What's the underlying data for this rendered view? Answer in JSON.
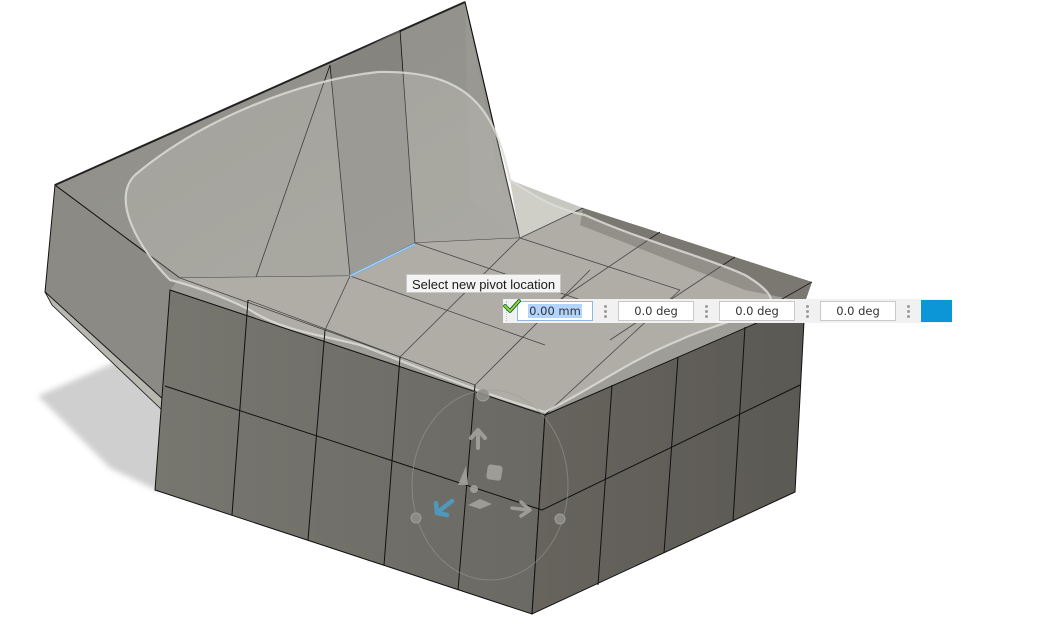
{
  "viewport": {
    "mode": "edit-form-transform",
    "background": "#ffffff",
    "model_color": "#8a8882",
    "selected_edge_color": "#4ea3f2"
  },
  "tooltip": {
    "text": "Select new pivot location"
  },
  "manipulator_toolbar": {
    "fields": [
      {
        "name": "distance",
        "value": "0.00 mm",
        "active": true
      },
      {
        "name": "rotation-1",
        "value": "0.0 deg",
        "active": false
      },
      {
        "name": "rotation-2",
        "value": "0.0 deg",
        "active": false
      },
      {
        "name": "rotation-3",
        "value": "0.0 deg",
        "active": false
      }
    ],
    "ok_button": {
      "icon": "checkmark-icon",
      "color": "#0d96d7"
    }
  },
  "gizmo": {
    "icons": [
      "arrow-up-icon",
      "arrow-right-icon",
      "arrow-left-down-icon",
      "plane-square-icon",
      "plane-diamond-icon",
      "rotation-ring-icon",
      "pivot-dot-icon"
    ],
    "active_axis_color": "#4a9dc5"
  }
}
